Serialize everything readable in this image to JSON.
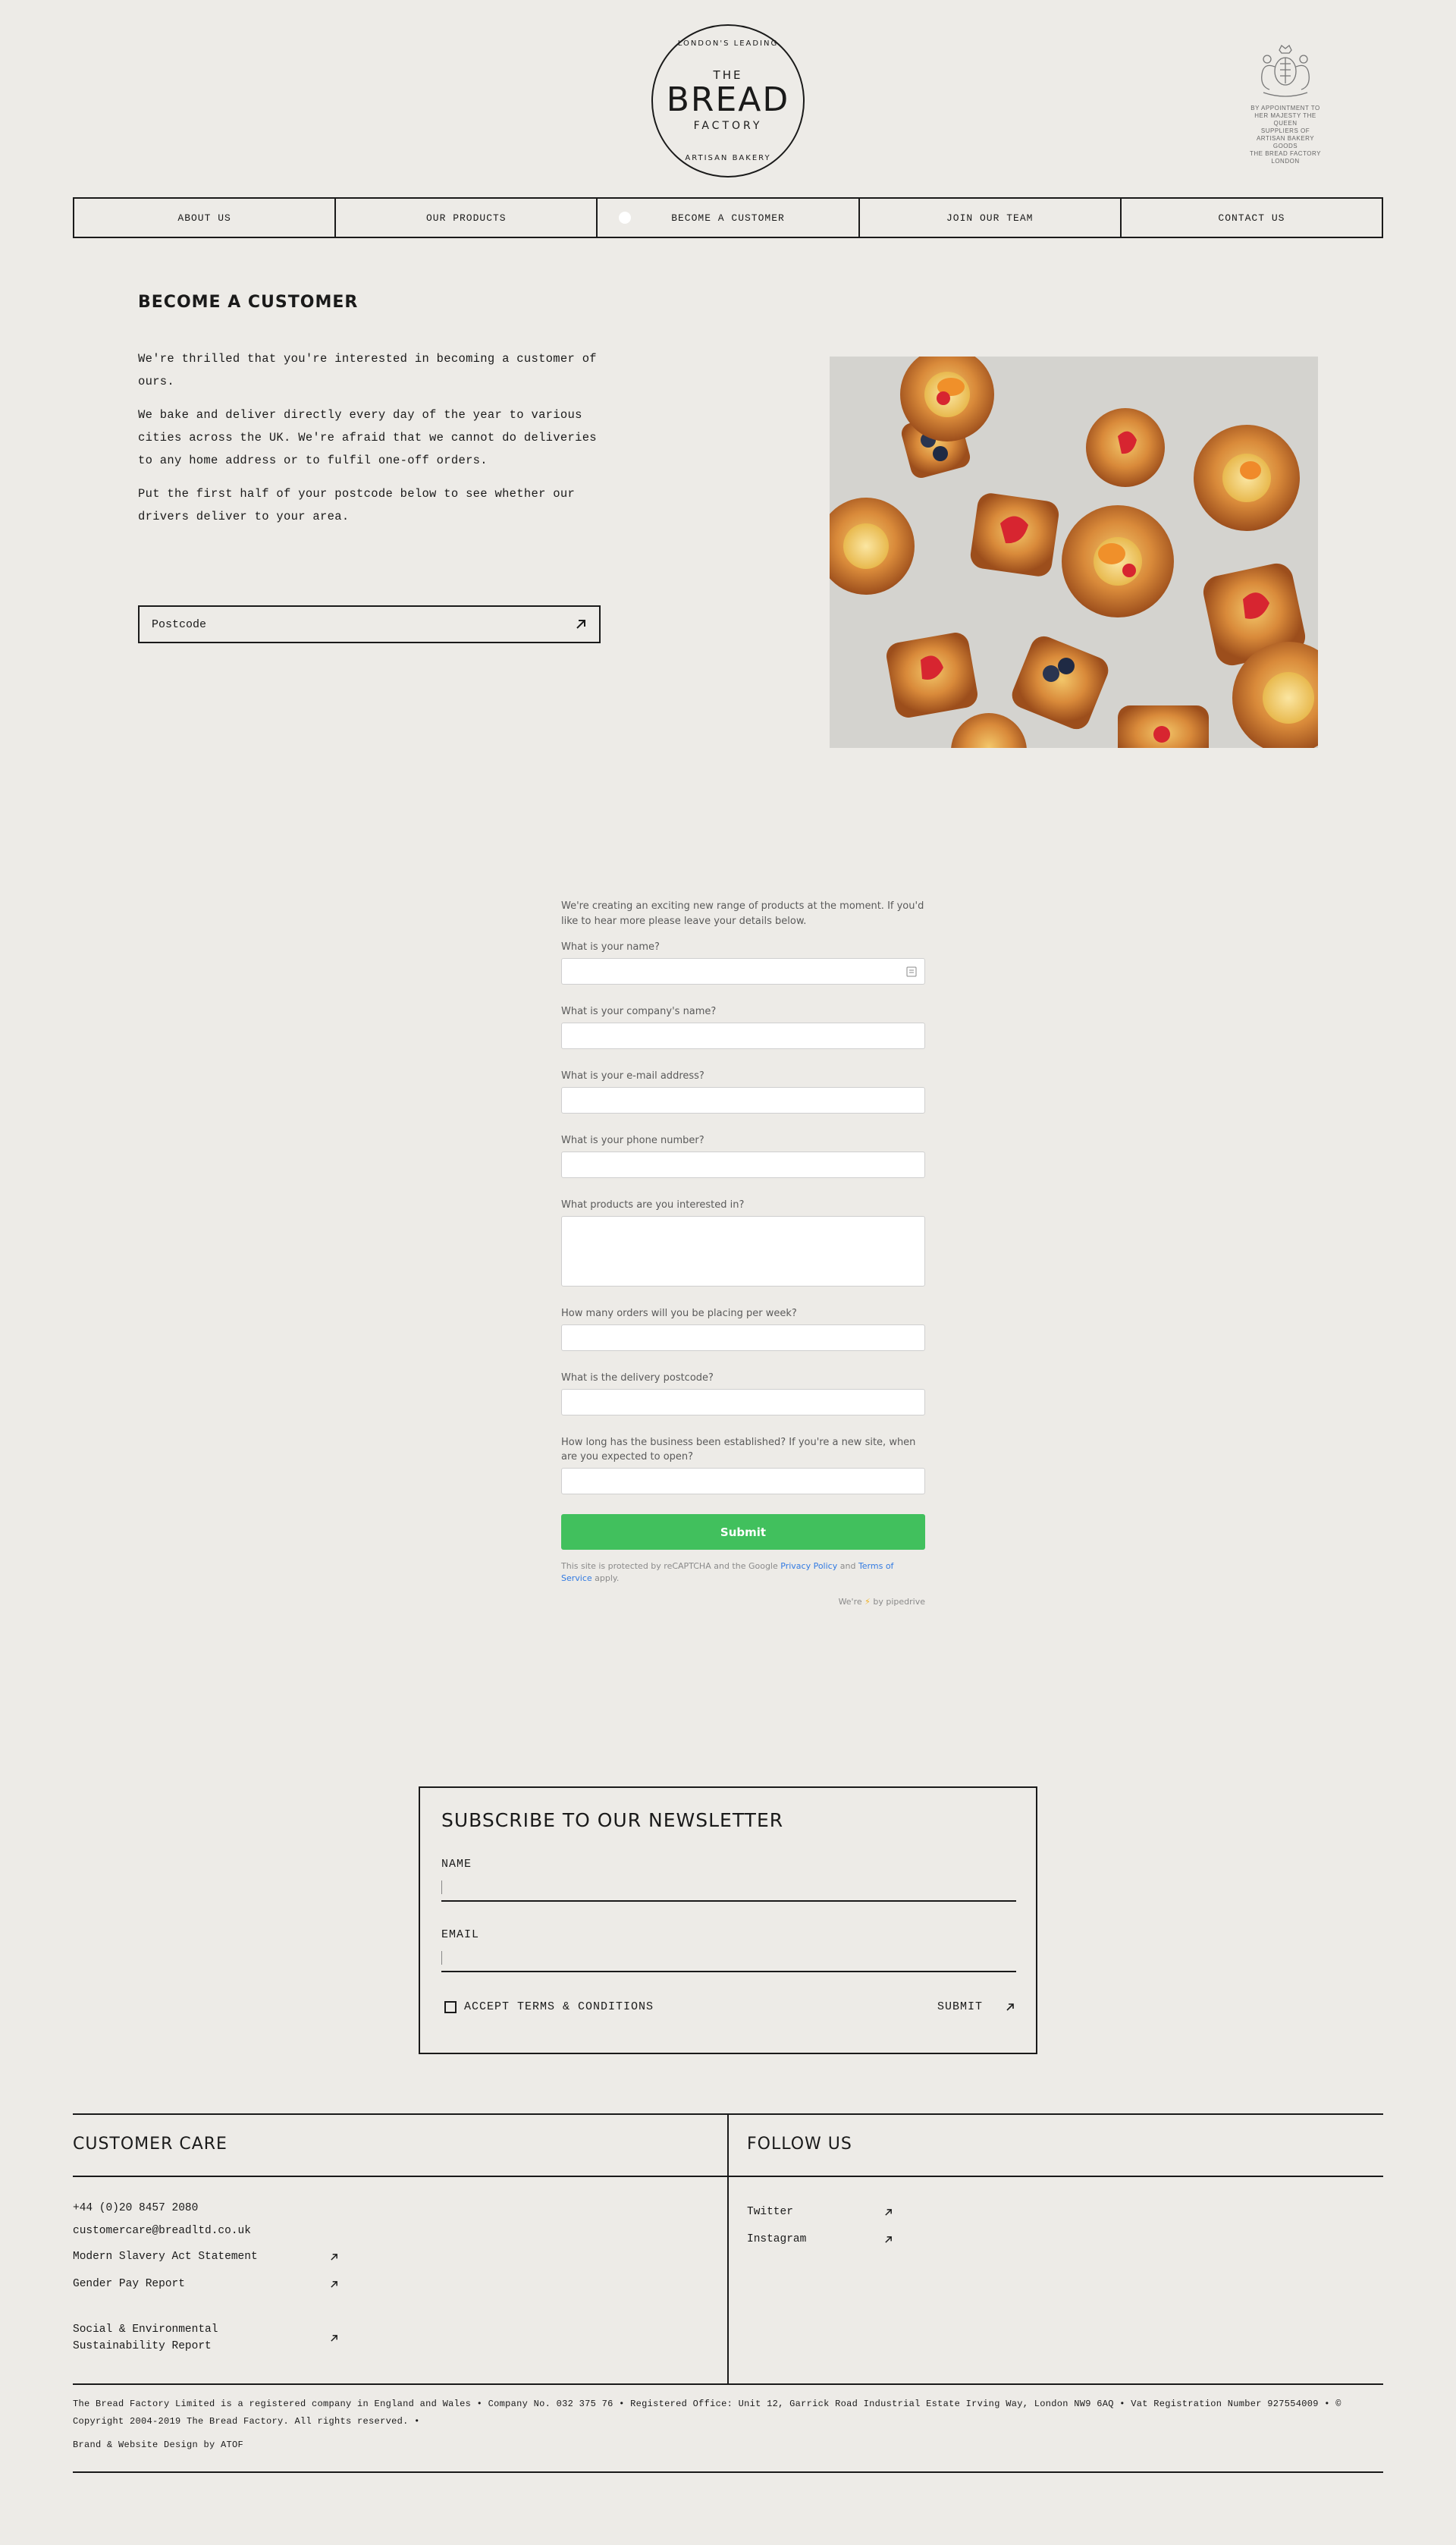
{
  "logo": {
    "ring_top": "LONDON'S LEADING",
    "the": "THE",
    "bread": "BREAD",
    "factory": "FACTORY",
    "ring_bottom": "ARTISAN BAKERY"
  },
  "royal_warrant": {
    "line1": "BY APPOINTMENT TO",
    "line2": "HER MAJESTY THE QUEEN",
    "line3": "SUPPLIERS OF",
    "line4": "ARTISAN BAKERY GOODS",
    "line5": "THE BREAD FACTORY",
    "line6": "LONDON"
  },
  "nav": {
    "items": [
      "ABOUT US",
      "OUR PRODUCTS",
      "BECOME A CUSTOMER",
      "JOIN OUR TEAM",
      "CONTACT US"
    ]
  },
  "become": {
    "title": "BECOME A CUSTOMER",
    "p1": "We're thrilled that you're interested in becoming a customer of ours.",
    "p2": "We bake and deliver directly every day of the year to various cities across the UK. We're afraid that we cannot do deliveries to any home address or to fulfil one-off orders.",
    "p3": "Put the first half of your postcode below to see whether our drivers deliver to your area.",
    "postcode_placeholder": "Postcode"
  },
  "form": {
    "description": "We're creating an exciting new range of products at the moment. If you'd like to hear more please leave your details below.",
    "fields": [
      "What is your name?",
      "What is your company's name?",
      "What is your e-mail address?",
      "What is your phone number?",
      "What products are you interested in?",
      "How many orders will you be placing per week?",
      "What is the delivery postcode?",
      "How long has the business been established? If you're a new site, when are you expected to open?"
    ],
    "submit": "Submit",
    "legal_prefix": "This site is protected by reCAPTCHA and the Google",
    "privacy": "Privacy Policy",
    "and": "and",
    "terms": "Terms of Service",
    "apply": "apply.",
    "powered_pre": "We're",
    "powered_by": "by pipedrive"
  },
  "newsletter": {
    "title": "SUBSCRIBE TO OUR NEWSLETTER",
    "name_label": "NAME",
    "email_label": "EMAIL",
    "accept": "ACCEPT TERMS & CONDITIONS",
    "submit": "SUBMIT"
  },
  "footer": {
    "care_title": "CUSTOMER CARE",
    "follow_title": "FOLLOW US",
    "phone": "+44 (0)20 8457 2080",
    "email": "customercare@breadltd.co.uk",
    "links": [
      "Modern Slavery Act Statement",
      "Gender Pay Report"
    ],
    "social_env_1": "Social & Environmental",
    "social_env_2": "Sustainability Report",
    "social": [
      "Twitter",
      "Instagram"
    ],
    "company": "The Bread Factory Limited is a registered company in England and Wales • Company No. 032 375 76 • Registered Office: Unit 12, Garrick Road Industrial Estate Irving Way, London NW9 6AQ • Vat Registration Number 927554009 • ©",
    "copyright": "Copyright 2004-2019 The Bread Factory. All rights reserved. •",
    "credit": "Brand & Website Design by ATOF"
  },
  "colors": {
    "background": "#edebe7",
    "submit_green": "#41c05d",
    "link_blue": "#317ae2"
  }
}
